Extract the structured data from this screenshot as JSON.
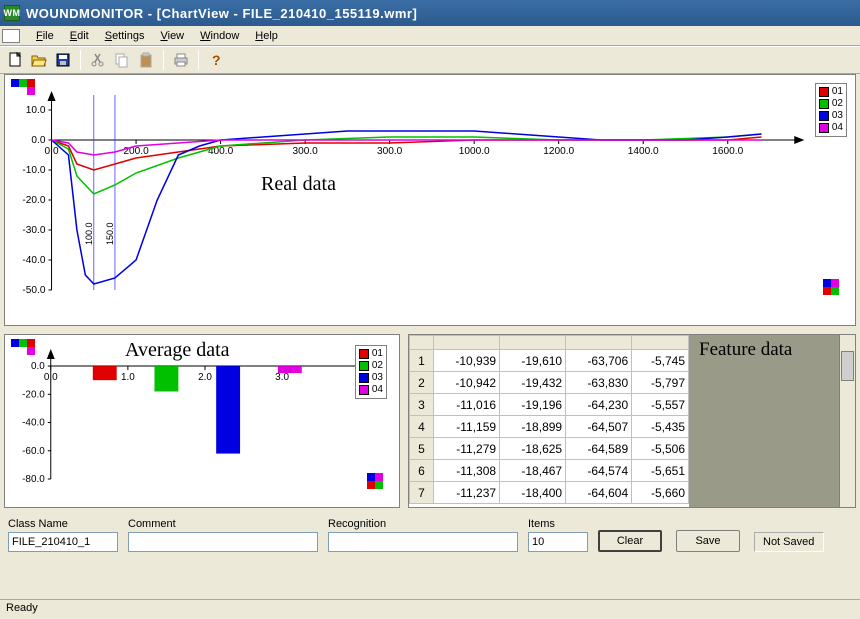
{
  "title": "WOUNDMONITOR - [ChartView - FILE_210410_155119.wmr]",
  "menu": {
    "file": "File",
    "edit": "Edit",
    "settings": "Settings",
    "view": "View",
    "window": "Window",
    "help": "Help"
  },
  "labels": {
    "real_data": "Real data",
    "average_data": "Average data",
    "feature_data": "Feature data"
  },
  "legend": {
    "series": [
      {
        "name": "01",
        "color": "#e00000"
      },
      {
        "name": "02",
        "color": "#00c000"
      },
      {
        "name": "03",
        "color": "#0000e0"
      },
      {
        "name": "04",
        "color": "#e000e0"
      }
    ]
  },
  "form": {
    "class_name_label": "Class Name",
    "class_name_value": "FILE_210410_1",
    "comment_label": "Comment",
    "comment_value": "",
    "recognition_label": "Recognition",
    "recognition_value": "",
    "items_label": "Items",
    "items_value": "10",
    "clear": "Clear",
    "save": "Save",
    "not_saved": "Not Saved"
  },
  "status": "Ready",
  "table": {
    "rows": [
      [
        "-10,939",
        "-19,610",
        "-63,706",
        "-5,745"
      ],
      [
        "-10,942",
        "-19,432",
        "-63,830",
        "-5,797"
      ],
      [
        "-11,016",
        "-19,196",
        "-64,230",
        "-5,557"
      ],
      [
        "-11,159",
        "-18,899",
        "-64,507",
        "-5,435"
      ],
      [
        "-11,279",
        "-18,625",
        "-64,589",
        "-5,506"
      ],
      [
        "-11,308",
        "-18,467",
        "-64,574",
        "-5,651"
      ],
      [
        "-11,237",
        "-18,400",
        "-64,604",
        "-5,660"
      ]
    ]
  },
  "chart_data": [
    {
      "type": "line",
      "title": "Real data",
      "xlabel": "",
      "ylabel": "",
      "xlim": [
        0,
        1700
      ],
      "ylim": [
        -50,
        15
      ],
      "xticks": [
        0,
        200,
        400,
        600,
        800,
        1000,
        1200,
        1400,
        1600
      ],
      "xticklabels": [
        "0.0",
        "200.0",
        "400.0",
        "300.0",
        "300.0",
        "1000.0",
        "1200.0",
        "1400.0",
        "1600.0"
      ],
      "yticks": [
        -50,
        -40,
        -30,
        -20,
        -10,
        0,
        10
      ],
      "yticklabels": [
        "-50.0",
        "-40.0",
        "-30.0",
        "-20.0",
        "-10.0",
        "0.0",
        "10.0"
      ],
      "markers": {
        "type": "vertical_lines",
        "x": [
          100,
          150
        ],
        "labels": [
          "100.0",
          "150.0"
        ]
      },
      "series": [
        {
          "name": "01",
          "color": "#e00000",
          "x": [
            0,
            40,
            60,
            100,
            150,
            200,
            300,
            400,
            600,
            800,
            1000,
            1200,
            1400,
            1600,
            1680
          ],
          "y": [
            0,
            -2,
            -8,
            -10,
            -8,
            -6,
            -4,
            -2,
            -1,
            -1,
            0,
            0,
            0,
            0,
            1
          ]
        },
        {
          "name": "02",
          "color": "#00c000",
          "x": [
            0,
            40,
            60,
            100,
            150,
            200,
            300,
            400,
            600,
            800,
            1000,
            1200,
            1400,
            1600,
            1680
          ],
          "y": [
            0,
            -3,
            -12,
            -18,
            -15,
            -11,
            -6,
            -2,
            0,
            1,
            1,
            0,
            0,
            1,
            2
          ]
        },
        {
          "name": "03",
          "color": "#0000e0",
          "x": [
            0,
            40,
            60,
            80,
            100,
            150,
            200,
            250,
            300,
            350,
            400,
            500,
            600,
            700,
            800,
            900,
            1000,
            1100,
            1200,
            1300,
            1400,
            1500,
            1600,
            1680
          ],
          "y": [
            0,
            -5,
            -30,
            -45,
            -48,
            -46,
            -40,
            -20,
            -5,
            -2,
            0,
            1,
            2,
            3,
            3,
            3,
            3,
            2,
            1,
            0,
            0,
            0,
            1,
            2
          ]
        },
        {
          "name": "04",
          "color": "#e000e0",
          "x": [
            0,
            40,
            60,
            100,
            150,
            200,
            300,
            400,
            600,
            800,
            1000,
            1200,
            1400,
            1600,
            1680
          ],
          "y": [
            0,
            -1,
            -4,
            -5,
            -4,
            -2,
            -1,
            0,
            0,
            0,
            0,
            0,
            0,
            0,
            0
          ]
        }
      ]
    },
    {
      "type": "bar",
      "title": "Average data",
      "xlabel": "",
      "ylabel": "",
      "xlim": [
        0,
        4
      ],
      "ylim": [
        -80,
        5
      ],
      "xticks": [
        0,
        1,
        2,
        3
      ],
      "xticklabels": [
        "0.0",
        "1.0",
        "2.0",
        "3.0"
      ],
      "yticks": [
        -80,
        -60,
        -40,
        -20,
        0
      ],
      "yticklabels": [
        "-80.0",
        "-60.0",
        "-40.0",
        "-20.0",
        "0.0"
      ],
      "series": [
        {
          "name": "01",
          "color": "#e00000",
          "x": 0.7,
          "value": -10
        },
        {
          "name": "02",
          "color": "#00c000",
          "x": 1.5,
          "value": -18
        },
        {
          "name": "03",
          "color": "#0000e0",
          "x": 2.3,
          "value": -62
        },
        {
          "name": "04",
          "color": "#e000e0",
          "x": 3.1,
          "value": -5
        }
      ]
    }
  ]
}
